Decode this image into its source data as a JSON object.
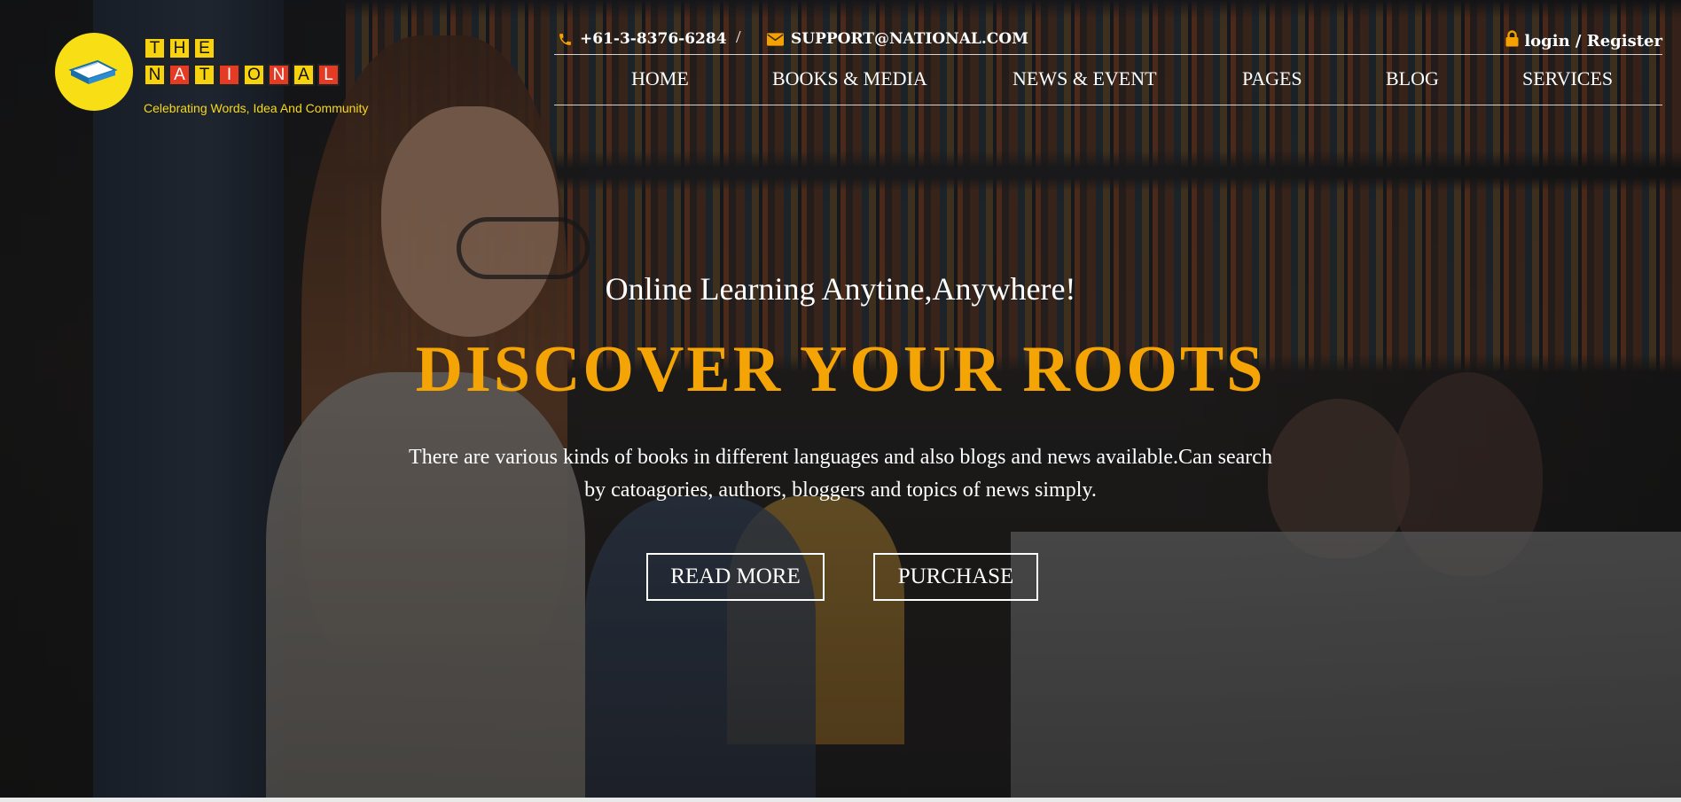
{
  "brand": {
    "row1": [
      "T",
      "H",
      "E"
    ],
    "row2": [
      "N",
      "A",
      "T",
      "I",
      "O",
      "N",
      "A",
      "L"
    ],
    "tagline": "Celebrating Words, Idea And Community"
  },
  "topbar": {
    "phone": "+61-3-8376-6284",
    "separator": "/",
    "email": "SUPPORT@NATIONAL.COM",
    "login": "login / Register",
    "icon_color": "#f5a100"
  },
  "nav": {
    "items": [
      "HOME",
      "BOOKS & MEDIA",
      "NEWS & EVENT",
      "PAGES",
      "BLOG",
      "SERVICES"
    ]
  },
  "hero": {
    "subtitle": "Online Learning Anytine,Anywhere!",
    "headline": "DISCOVER YOUR ROOTS",
    "description": "There are various kinds of books in different languages and also blogs and news available.Can search by catoagories, authors, bloggers and topics of news simply.",
    "read_more": "READ MORE",
    "purchase": "PURCHASE",
    "headline_color": "#f5a406"
  },
  "icons": {
    "phone": "phone-icon",
    "email": "envelope-icon",
    "lock": "lock-icon",
    "logo": "book-icon"
  }
}
